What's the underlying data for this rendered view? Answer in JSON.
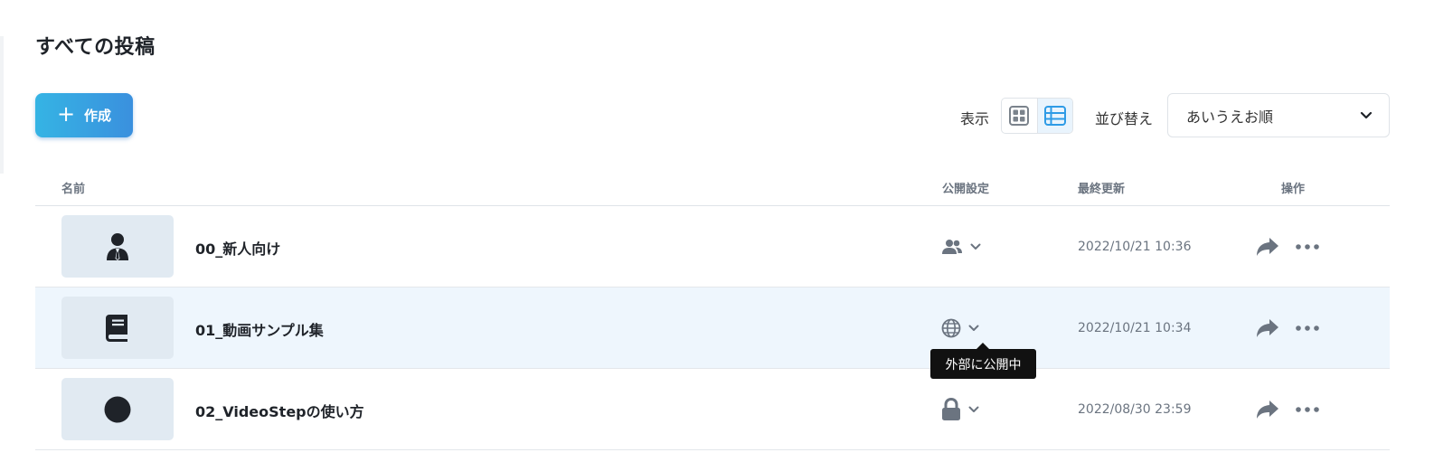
{
  "page": {
    "title": "すべての投稿"
  },
  "toolbar": {
    "create_label": "作成",
    "view_label": "表示",
    "view_modes": [
      "grid",
      "list"
    ],
    "active_view": "list",
    "sort_label": "並び替え",
    "sort_value": "あいうえお順"
  },
  "table": {
    "headers": {
      "name": "名前",
      "visibility": "公開設定",
      "updated": "最終更新",
      "actions": "操作"
    },
    "rows": [
      {
        "title": "00_新人向け",
        "thumb_icon": "user-tie-icon",
        "visibility": "group",
        "updated": "2022/10/21 10:36"
      },
      {
        "title": "01_動画サンプル集",
        "thumb_icon": "book-icon",
        "visibility": "public",
        "updated": "2022/10/21 10:34"
      },
      {
        "title": "02_VideoStepの使い方",
        "thumb_icon": "circle-icon",
        "visibility": "private",
        "updated": "2022/08/30 23:59"
      }
    ]
  },
  "tooltip": {
    "text": "外部に公開中"
  },
  "colors": {
    "accent_start": "#35b4e4",
    "accent_end": "#3a90de",
    "row_hover": "#eef6fd",
    "icon_gray": "#6b7480",
    "active_view": "#2e9be6"
  }
}
